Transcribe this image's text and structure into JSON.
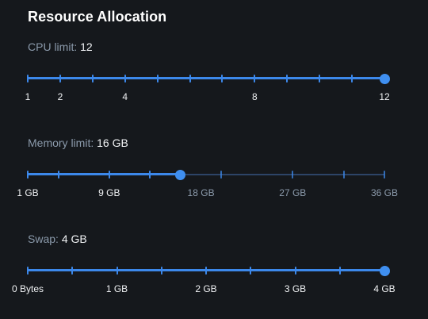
{
  "title": "Resource Allocation",
  "accent_color": "#3c88ea",
  "sliders": [
    {
      "id": "cpu",
      "label": "CPU limit:",
      "value_text": "12",
      "min": 1,
      "max": 12,
      "value": 12,
      "ticks": [
        1,
        2,
        3,
        4,
        5,
        6,
        7,
        8,
        9,
        10,
        11,
        12
      ],
      "marks": [
        {
          "value": 1,
          "text": "1"
        },
        {
          "value": 2,
          "text": "2"
        },
        {
          "value": 4,
          "text": "4"
        },
        {
          "value": 8,
          "text": "8"
        },
        {
          "value": 12,
          "text": "12"
        }
      ]
    },
    {
      "id": "memory",
      "label": "Memory limit:",
      "value_text": "16 GB",
      "min": 1,
      "max": 36,
      "value": 16,
      "ticks": [
        1,
        4,
        9,
        13,
        16,
        20,
        27,
        32,
        36
      ],
      "marks": [
        {
          "value": 1,
          "text": "1 GB"
        },
        {
          "value": 9,
          "text": "9 GB"
        },
        {
          "value": 18,
          "text": "18 GB"
        },
        {
          "value": 27,
          "text": "27 GB"
        },
        {
          "value": 36,
          "text": "36 GB"
        }
      ]
    },
    {
      "id": "swap",
      "label": "Swap:",
      "value_text": "4 GB",
      "min": 0,
      "max": 4,
      "value": 4,
      "ticks": [
        0,
        0.5,
        1,
        1.5,
        2,
        2.5,
        3,
        3.5,
        4
      ],
      "marks": [
        {
          "value": 0,
          "text": "0 Bytes"
        },
        {
          "value": 1,
          "text": "1 GB"
        },
        {
          "value": 2,
          "text": "2 GB"
        },
        {
          "value": 3,
          "text": "3 GB"
        },
        {
          "value": 4,
          "text": "4 GB"
        }
      ]
    }
  ]
}
